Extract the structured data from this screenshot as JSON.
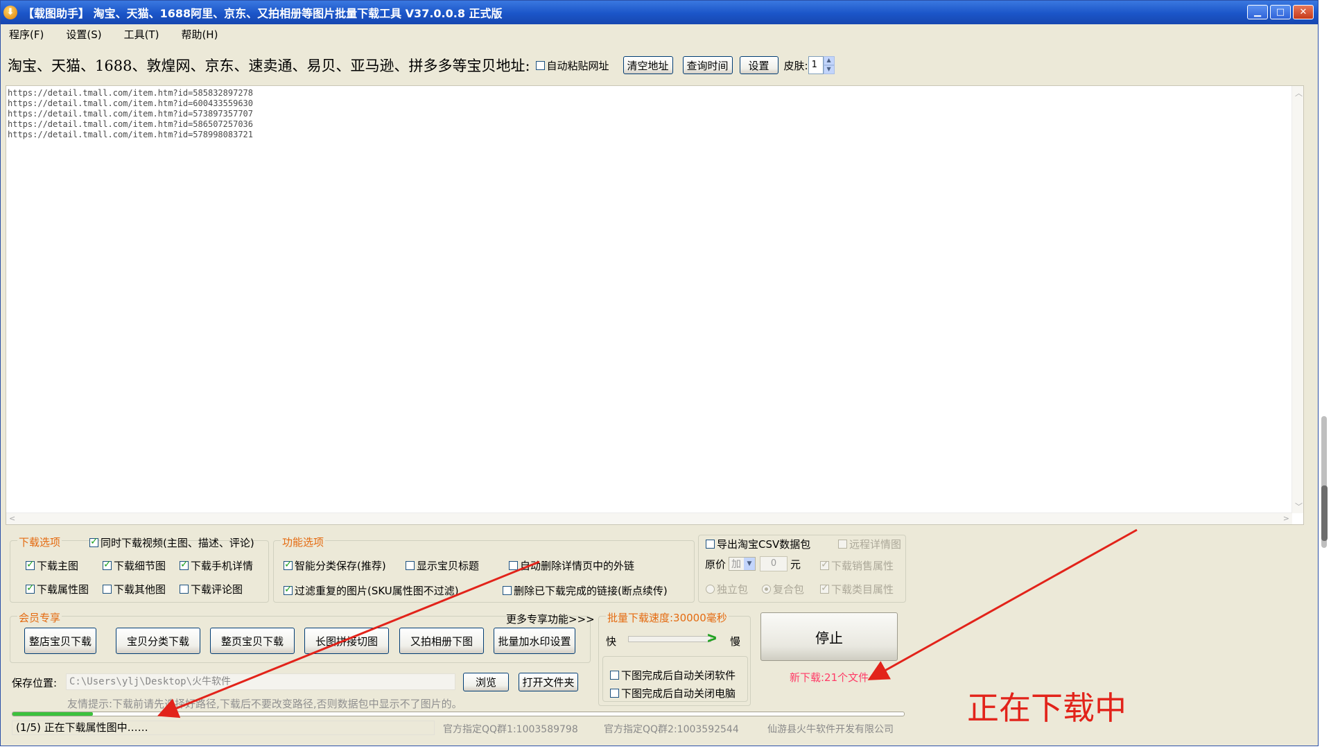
{
  "window": {
    "title": "【载图助手】 淘宝、天猫、1688阿里、京东、又拍相册等图片批量下载工具 V37.0.0.8 正式版",
    "icon": "download-arrow-icon",
    "controls": {
      "minimize": "▁",
      "maximize": "□",
      "close": "✕"
    }
  },
  "menu": [
    "程序(F)",
    "设置(S)",
    "工具(T)",
    "帮助(H)"
  ],
  "toolbar": {
    "url_label": "淘宝、天猫、1688、敦煌网、京东、速卖通、易贝、亚马逊、拼多多等宝贝地址:",
    "auto_paste": "自动粘贴网址",
    "clear_btn": "清空地址",
    "query_btn": "查询时间",
    "settings_btn": "设置",
    "skin_label": "皮肤:",
    "skin_value": "1"
  },
  "urls": [
    "https://detail.tmall.com/item.htm?id=585832897278",
    "https://detail.tmall.com/item.htm?id=600433559630",
    "https://detail.tmall.com/item.htm?id=573897357707",
    "https://detail.tmall.com/item.htm?id=586507257036",
    "https://detail.tmall.com/item.htm?id=578998083721"
  ],
  "download_options": {
    "title": "下载选项",
    "video": "同时下载视频(主图、描述、评论)",
    "main_img": "下载主图",
    "detail_img": "下载细节图",
    "mobile_detail": "下载手机详情",
    "attr_img": "下载属性图",
    "other_img": "下载其他图",
    "review_img": "下载评论图"
  },
  "feature_options": {
    "title": "功能选项",
    "smart_save": "智能分类保存(推荐)",
    "show_title": "显示宝贝标题",
    "auto_remove_links": "自动删除详情页中的外链",
    "filter_dup": "过滤重复的图片(SKU属性图不过滤)",
    "delete_done": "删除已下载完成的链接(断点续传)"
  },
  "csv_options": {
    "export_csv": "导出淘宝CSV数据包",
    "remote_detail": "远程详情图",
    "price_label": "原价",
    "price_op": "加",
    "price_value": "0",
    "price_unit": "元",
    "sales_attr": "下载销售属性",
    "standalone": "独立包",
    "composite": "复合包",
    "category_attr": "下载类目属性"
  },
  "member": {
    "title": "会员专享",
    "more": "更多专享功能>>>",
    "buttons": [
      "整店宝贝下载",
      "宝贝分类下载",
      "整页宝贝下载",
      "长图拼接切图",
      "又拍相册下图",
      "批量加水印设置"
    ]
  },
  "speed": {
    "title": "批量下载速度:30000毫秒",
    "fast": "快",
    "slow": "慢",
    "auto_close_app": "下图完成后自动关闭软件",
    "auto_shutdown": "下图完成后自动关闭电脑"
  },
  "stop_btn": "停止",
  "new_downloads": "新下载:21个文件",
  "save": {
    "label": "保存位置:",
    "path": "C:\\Users\\ylj\\Desktop\\火牛软件",
    "browse": "浏览",
    "open_folder": "打开文件夹",
    "tip": "友情提示:下载前请先选择好路径,下载后不要改变路径,否则数据包中显示不了图片的。"
  },
  "progress": {
    "fraction": 0.09
  },
  "status": {
    "message": "(1/5) 正在下载属性图中……",
    "qq1": "官方指定QQ群1:1003589798",
    "qq2": "官方指定QQ群2:1003592544",
    "company": "仙游县火牛软件开发有限公司"
  },
  "annotation": {
    "text": "正在下载中"
  },
  "colors": {
    "accent_orange": "#e46a10",
    "annotation_red": "#e2231a",
    "new_dl_pink": "#ff3a66"
  }
}
